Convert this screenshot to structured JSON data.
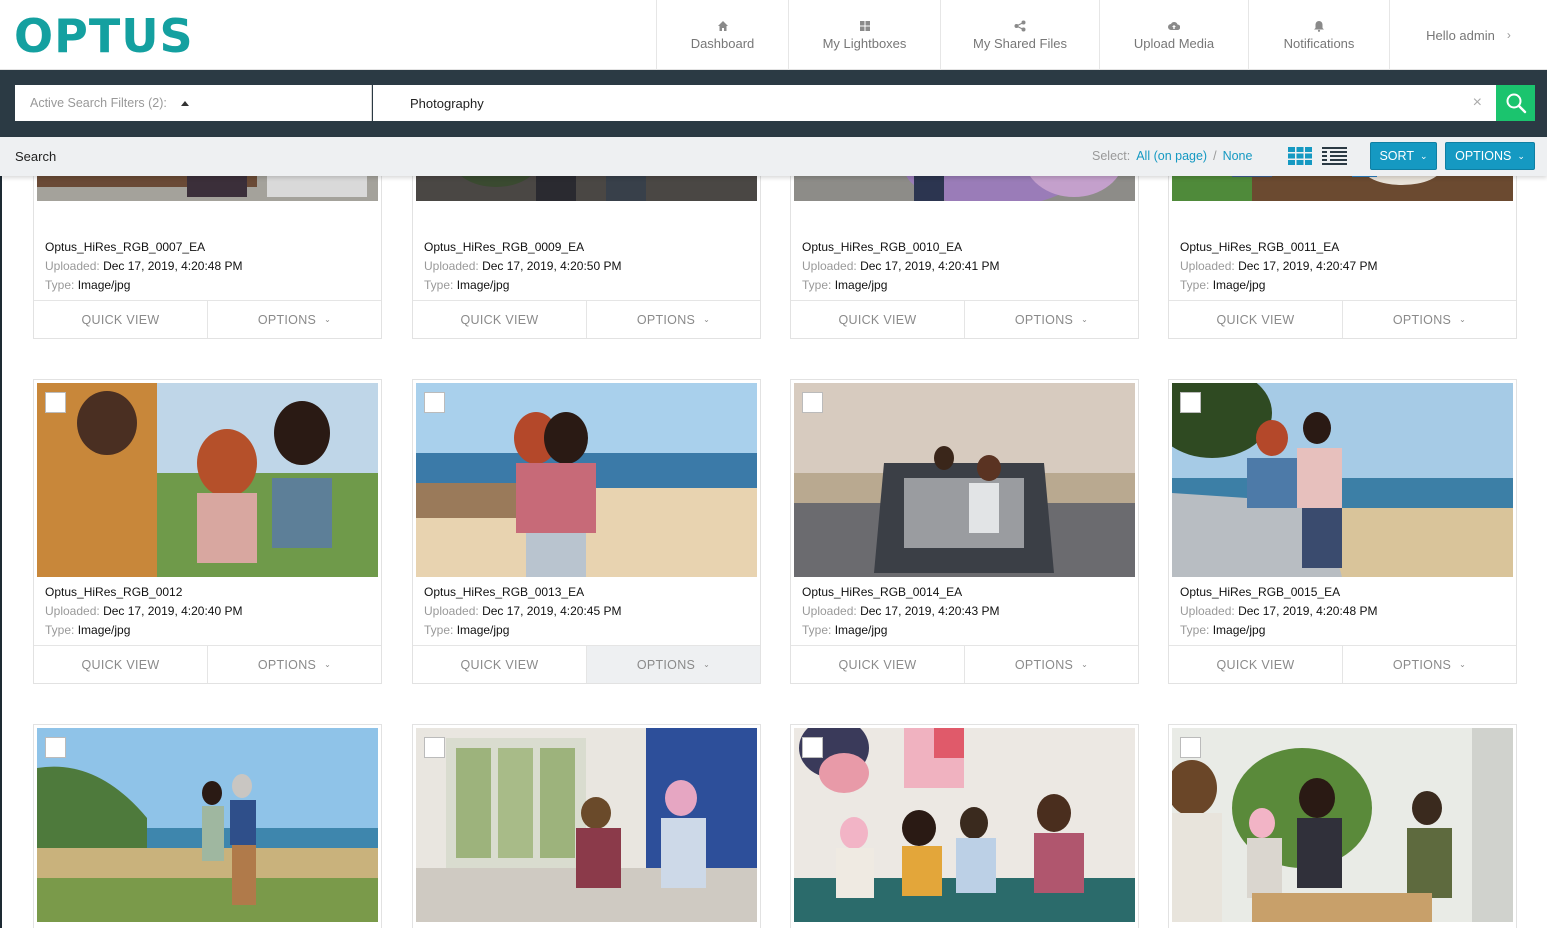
{
  "brand": {
    "logo_text": "OPTUS",
    "color": "#14a0a0"
  },
  "nav": [
    {
      "label": "Dashboard",
      "icon": "home-icon"
    },
    {
      "label": "My Lightboxes",
      "icon": "grid-icon"
    },
    {
      "label": "My Shared Files",
      "icon": "share-icon"
    },
    {
      "label": "Upload Media",
      "icon": "cloud-upload-icon"
    },
    {
      "label": "Notifications",
      "icon": "bell-icon"
    }
  ],
  "user": {
    "greeting": "Hello admin"
  },
  "search": {
    "filters_label": "Active Search Filters (2):",
    "query": "Photography",
    "accent": "#1bc46e"
  },
  "toolbar": {
    "title": "Search",
    "select_label": "Select:",
    "select_all": "All (on page)",
    "separator": "/",
    "select_none": "None",
    "sort_label": "SORT",
    "options_label": "OPTIONS",
    "accent": "#1599c2"
  },
  "card_labels": {
    "uploaded": "Uploaded:",
    "type": "Type:",
    "quick_view": "QUICK VIEW",
    "options": "OPTIONS"
  },
  "rows": [
    [
      {
        "name": "Optus_HiRes_RGB_0007_EA",
        "uploaded": "Dec 17, 2019, 4:20:48 PM",
        "type": "Image/jpg"
      },
      {
        "name": "Optus_HiRes_RGB_0009_EA",
        "uploaded": "Dec 17, 2019, 4:20:50 PM",
        "type": "Image/jpg"
      },
      {
        "name": "Optus_HiRes_RGB_0010_EA",
        "uploaded": "Dec 17, 2019, 4:20:41 PM",
        "type": "Image/jpg"
      },
      {
        "name": "Optus_HiRes_RGB_0011_EA",
        "uploaded": "Dec 17, 2019, 4:20:47 PM",
        "type": "Image/jpg"
      }
    ],
    [
      {
        "name": "Optus_HiRes_RGB_0012",
        "uploaded": "Dec 17, 2019, 4:20:40 PM",
        "type": "Image/jpg"
      },
      {
        "name": "Optus_HiRes_RGB_0013_EA",
        "uploaded": "Dec 17, 2019, 4:20:45 PM",
        "type": "Image/jpg"
      },
      {
        "name": "Optus_HiRes_RGB_0014_EA",
        "uploaded": "Dec 17, 2019, 4:20:43 PM",
        "type": "Image/jpg"
      },
      {
        "name": "Optus_HiRes_RGB_0015_EA",
        "uploaded": "Dec 17, 2019, 4:20:48 PM",
        "type": "Image/jpg"
      }
    ]
  ]
}
